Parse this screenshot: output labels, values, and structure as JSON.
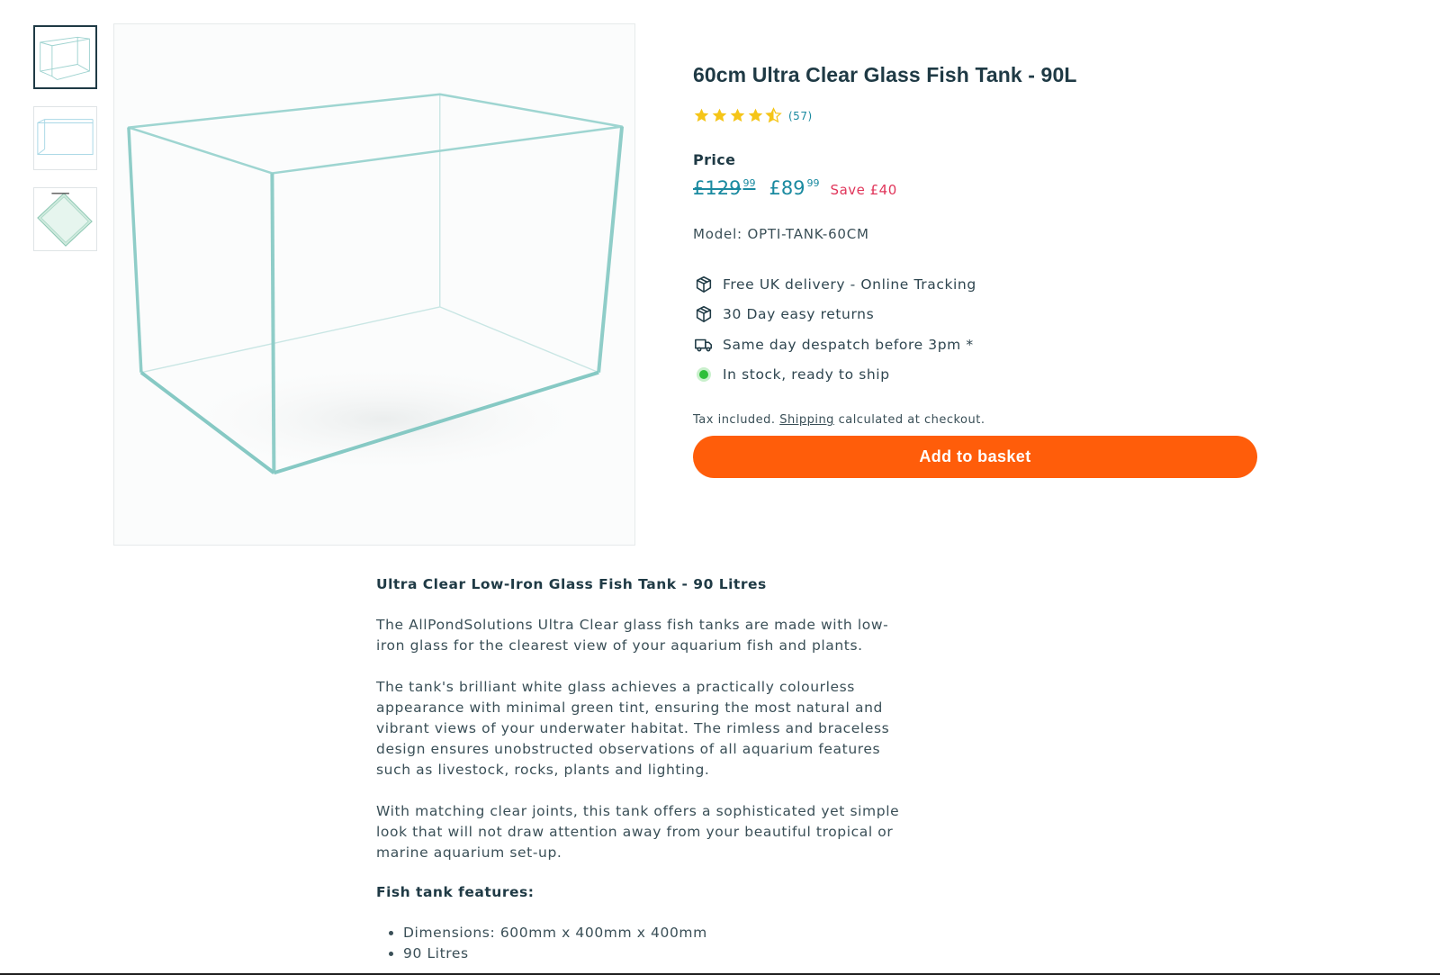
{
  "gallery": {
    "thumbnails": [
      "Ultra clear tank angled view",
      "Ultra clear tank front view",
      "Glass corner detail"
    ],
    "active_index": 0
  },
  "product": {
    "title": "60cm Ultra Clear Glass Fish Tank - 90L",
    "rating": {
      "stars": 4.5,
      "max": 5,
      "count_text": "(57)"
    },
    "price_label": "Price",
    "old_price": {
      "main": "£129",
      "pence": "99"
    },
    "new_price": {
      "main": "£89",
      "pence": "99"
    },
    "save_text": "Save £40",
    "model": "Model: OPTI-TANK-60CM",
    "features": [
      {
        "icon": "box-icon",
        "text": "Free UK delivery - Online Tracking"
      },
      {
        "icon": "box-icon",
        "text": "30 Day easy returns"
      },
      {
        "icon": "truck-icon",
        "text": "Same day despatch before 3pm *"
      },
      {
        "icon": "green-dot-icon",
        "text": "In stock, ready to ship"
      }
    ],
    "tax_prefix": "Tax included.",
    "tax_link": "Shipping",
    "tax_suffix": "calculated at checkout.",
    "add_to_basket": "Add to basket",
    "colors": {
      "accent": "#ff5d0a",
      "price": "#1a8aa0",
      "save": "#e0355a",
      "star": "#f5c518",
      "stock": "#2fbf3a"
    }
  },
  "description": {
    "heading": "Ultra Clear Low-Iron Glass Fish Tank - 90 Litres",
    "paragraphs": [
      "The AllPondSolutions Ultra Clear glass fish tanks are made with low-iron glass for the clearest view of your aquarium fish and plants.",
      "The tank's brilliant white glass achieves a practically colourless appearance with minimal green tint, ensuring the most natural and vibrant views of your underwater habitat. The rimless and braceless design ensures unobstructed observations of all aquarium features such as livestock, rocks, plants and lighting.",
      "With matching clear joints, this tank offers a sophisticated yet simple look that will not draw attention away from your beautiful tropical or marine aquarium set-up."
    ],
    "features_heading": "Fish tank features:",
    "features_list": [
      "Dimensions: 600mm x 400mm x 400mm",
      "90 Litres"
    ]
  }
}
